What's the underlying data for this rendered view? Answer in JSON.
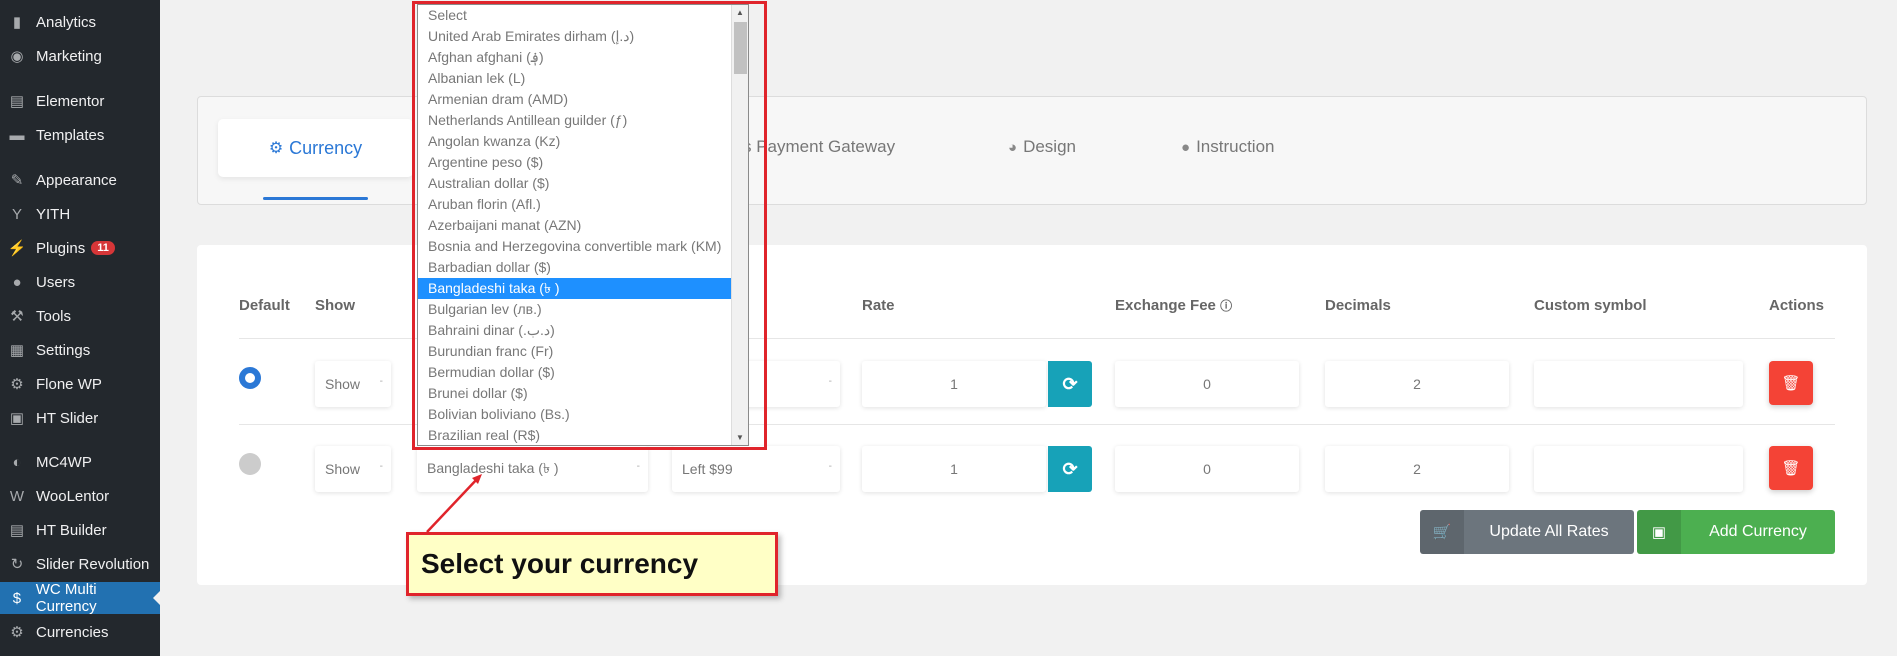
{
  "sidebar": {
    "items": [
      {
        "label": "Analytics",
        "icon": "bar-chart-icon"
      },
      {
        "label": "Marketing",
        "icon": "megaphone-icon"
      },
      {
        "label": "Elementor",
        "icon": "elementor-icon"
      },
      {
        "label": "Templates",
        "icon": "folder-icon"
      },
      {
        "label": "Appearance",
        "icon": "brush-icon"
      },
      {
        "label": "YITH",
        "icon": "yith-icon"
      },
      {
        "label": "Plugins",
        "icon": "plug-icon",
        "badge": "11"
      },
      {
        "label": "Users",
        "icon": "user-icon"
      },
      {
        "label": "Tools",
        "icon": "wrench-icon"
      },
      {
        "label": "Settings",
        "icon": "settings-icon"
      },
      {
        "label": "Flone WP",
        "icon": "gear-icon"
      },
      {
        "label": "HT Slider",
        "icon": "slider-icon"
      },
      {
        "label": "MC4WP",
        "icon": "mc4wp-icon"
      },
      {
        "label": "WooLentor",
        "icon": "woolentor-icon"
      },
      {
        "label": "HT Builder",
        "icon": "builder-icon"
      },
      {
        "label": "Slider Revolution",
        "icon": "revolution-icon"
      },
      {
        "label": "WC Multi Currency",
        "icon": "currency-icon",
        "active": true
      },
      {
        "label": "Currencies",
        "icon": "gear-icon"
      }
    ]
  },
  "tabs": {
    "currency": "Currency",
    "payment_gateway": "s Payment Gateway",
    "design": "Design",
    "instruction": "Instruction"
  },
  "table": {
    "headers": {
      "default": "Default",
      "show": "Show",
      "rate": "Rate",
      "exchange_fee": "Exchange Fee",
      "decimals": "Decimals",
      "custom_symbol": "Custom symbol",
      "actions": "Actions"
    },
    "rows": [
      {
        "default": true,
        "show": "Show",
        "currency": "",
        "position": "",
        "rate": "1",
        "exchange_fee": "0",
        "decimals": "2",
        "custom_symbol": ""
      },
      {
        "default": false,
        "show": "Show",
        "currency": "Bangladeshi taka (৳ )",
        "position": "Left $99",
        "rate": "1",
        "exchange_fee": "0",
        "decimals": "2",
        "custom_symbol": ""
      }
    ]
  },
  "buttons": {
    "update_all_rates": "Update All Rates",
    "add_currency": "Add Currency"
  },
  "dropdown": {
    "selected": "Bangladeshi taka (৳ )",
    "options": [
      "Select",
      "United Arab Emirates dirham (د.إ)",
      "Afghan afghani (؋)",
      "Albanian lek (L)",
      "Armenian dram (AMD)",
      "Netherlands Antillean guilder (ƒ)",
      "Angolan kwanza (Kz)",
      "Argentine peso ($)",
      "Australian dollar ($)",
      "Aruban florin (Afl.)",
      "Azerbaijani manat (AZN)",
      "Bosnia and Herzegovina convertible mark (KM)",
      "Barbadian dollar ($)",
      "Bangladeshi taka (৳ )",
      "Bulgarian lev (лв.)",
      "Bahraini dinar (.د.ب)",
      "Burundian franc (Fr)",
      "Bermudian dollar ($)",
      "Brunei dollar ($)",
      "Bolivian boliviano (Bs.)",
      "Brazilian real (R$)"
    ]
  },
  "callout": {
    "text": "Select your currency"
  },
  "colors": {
    "accent": "#2b78d6",
    "sidebar_bg": "#23282d",
    "active_sidebar": "#2271b1",
    "refresh": "#17a2b8",
    "delete": "#f44336",
    "add": "#4caf50",
    "update": "#6c757d",
    "annotation": "#e0242b"
  }
}
